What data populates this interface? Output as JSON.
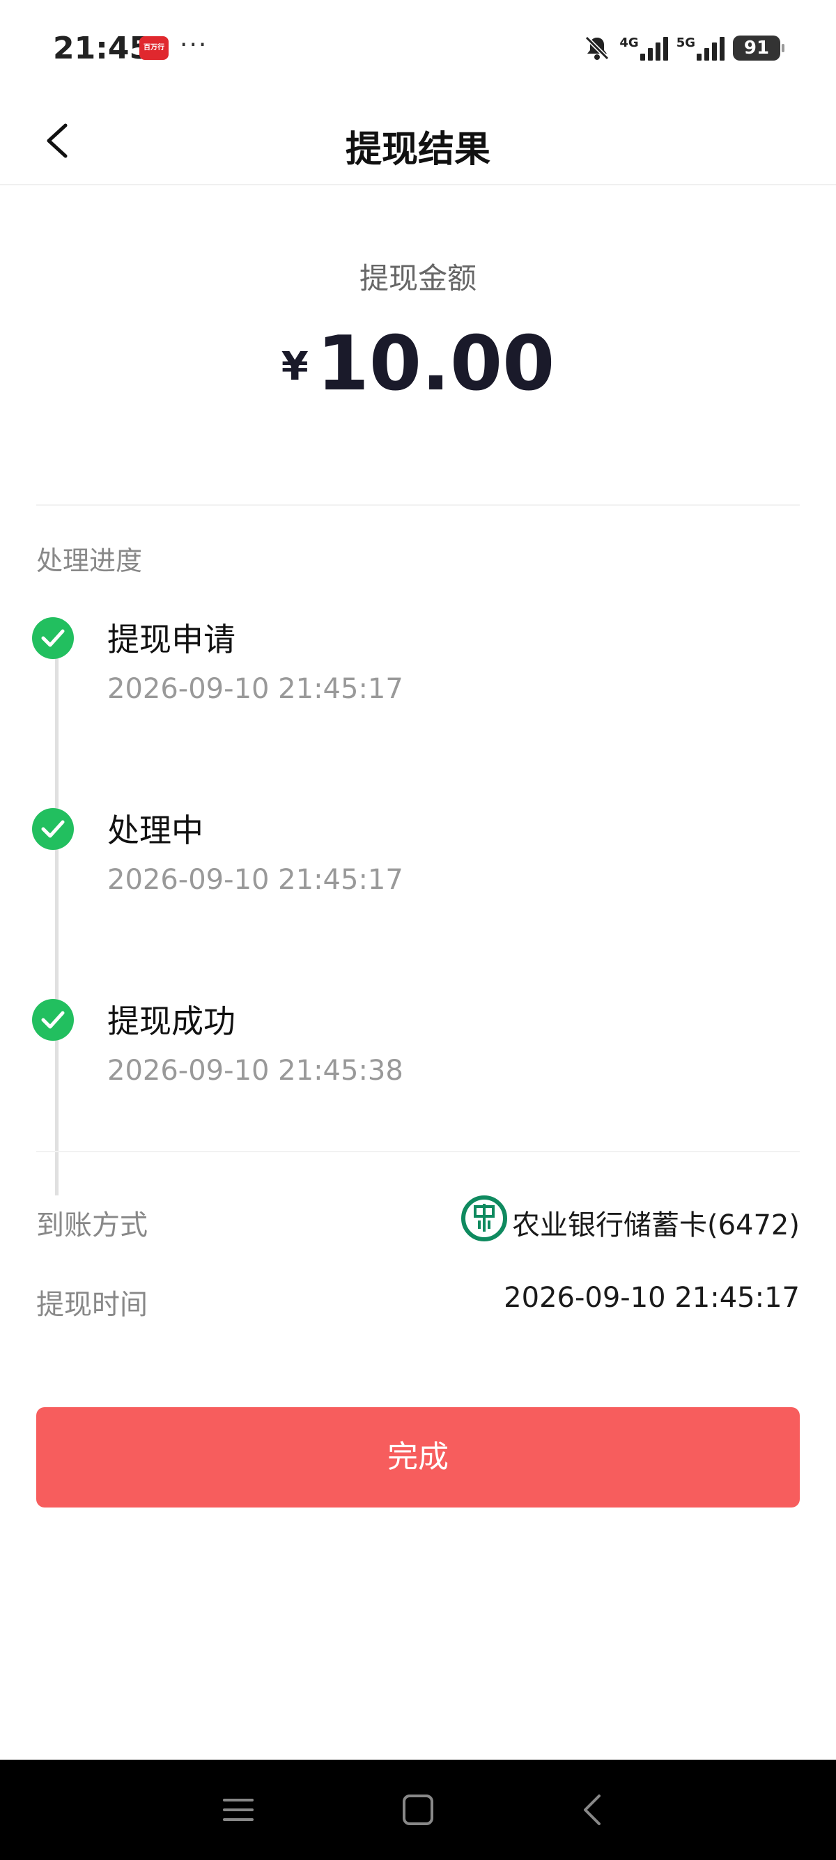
{
  "status_bar": {
    "time": "21:45",
    "app_badge": "百万行",
    "more": "···",
    "net1": "4G",
    "net2": "5G",
    "battery": "91"
  },
  "header": {
    "title": "提现结果"
  },
  "amount": {
    "label": "提现金额",
    "currency": "¥",
    "value": "10.00"
  },
  "progress": {
    "label": "处理进度",
    "steps": [
      {
        "title": "提现申请",
        "time": "2026-09-10 21:45:17"
      },
      {
        "title": "处理中",
        "time": "2026-09-10 21:45:17"
      },
      {
        "title": "提现成功",
        "time": "2026-09-10 21:45:38"
      }
    ]
  },
  "details": {
    "method_label": "到账方式",
    "method_value": "农业银行储蓄卡(6472)",
    "time_label": "提现时间",
    "time_value": "2026-09-10 21:45:17"
  },
  "done_button": "完成",
  "colors": {
    "accent": "#f75d5d",
    "success": "#22bf5f",
    "bank": "#0f8a5f"
  }
}
